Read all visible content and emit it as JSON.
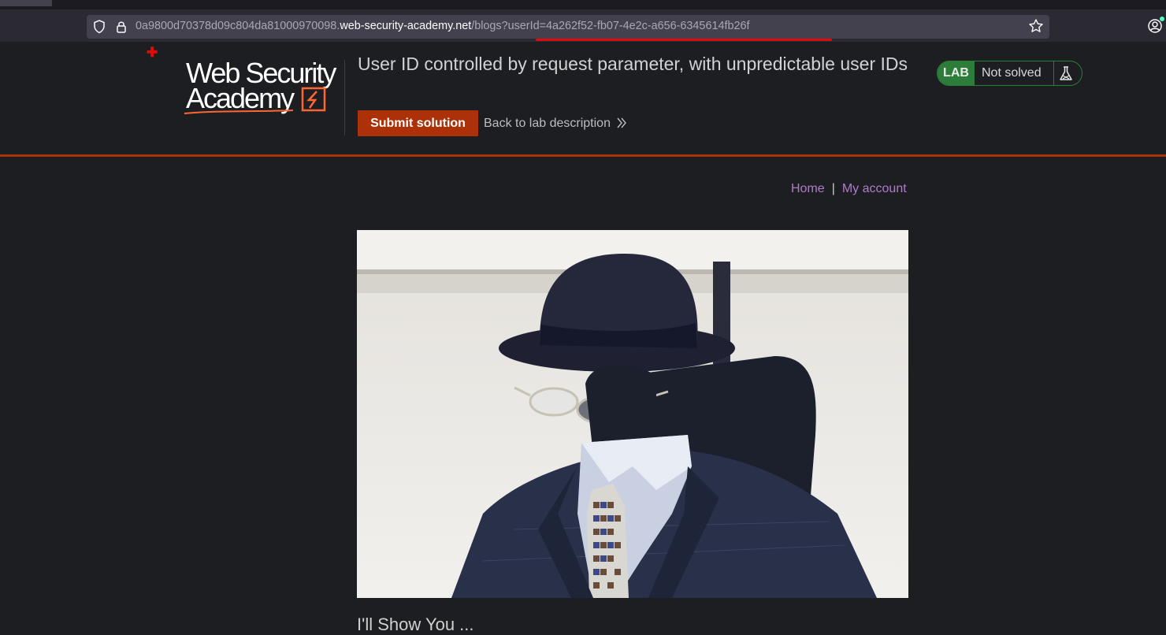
{
  "browser": {
    "url_host_prefix": "0a9800d70378d09c804da81000970098.",
    "url_host_domain": "web-security-academy.net",
    "url_path": "/blogs?userId=4a262f52-fb07-4e2c-a656-6345614fb26f"
  },
  "logo": {
    "line1": "Web Security",
    "line2": "Academy"
  },
  "lab": {
    "title": "User ID controlled by request parameter, with unpredictable user IDs",
    "submit_label": "Submit solution",
    "back_label": "Back to lab description",
    "tag": "LAB",
    "status": "Not solved",
    "accent_color": "#ac3108",
    "status_color": "#2c7d3a"
  },
  "nav": {
    "home": "Home",
    "separator": "|",
    "my_account": "My account"
  },
  "post": {
    "image_icon": "invisible-man-photo",
    "title_partial": "I'll Show You ..."
  }
}
